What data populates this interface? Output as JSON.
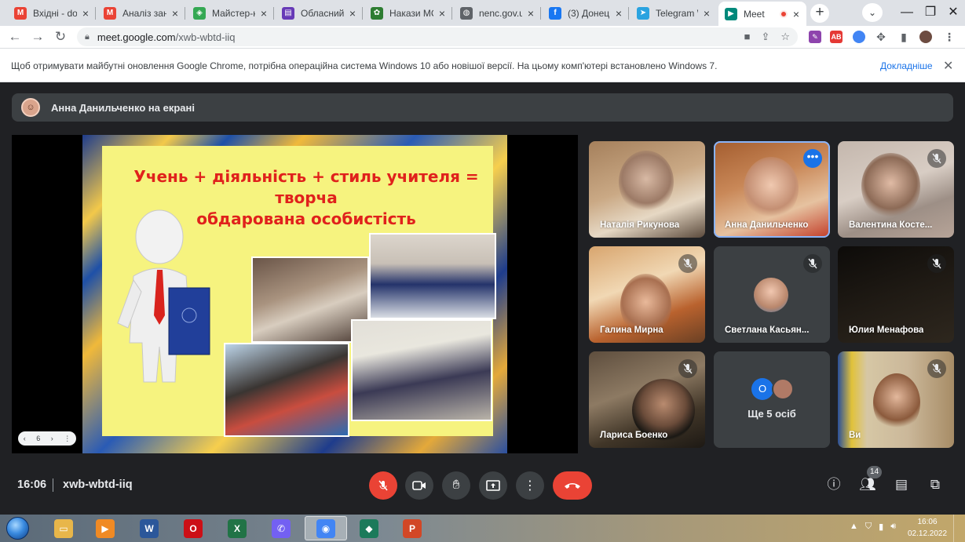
{
  "browser": {
    "tabs": [
      {
        "title": "Вхідні - dor",
        "icon": "gmail-icon",
        "color": "#ea4335",
        "glyph": "M"
      },
      {
        "title": "Аналіз зан",
        "icon": "gmail-icon",
        "color": "#ea4335",
        "glyph": "M"
      },
      {
        "title": "Майстер-к",
        "icon": "shield-site-icon",
        "color": "#34a853",
        "glyph": "◈"
      },
      {
        "title": "Обласний",
        "icon": "forms-icon",
        "color": "#673ab7",
        "glyph": "▤"
      },
      {
        "title": "Накази МС",
        "icon": "ministry-icon",
        "color": "#2e7d32",
        "glyph": "✿"
      },
      {
        "title": "nenc.gov.ua",
        "icon": "globe-icon",
        "color": "#5f6368",
        "glyph": "◍"
      },
      {
        "title": "(3) Донець",
        "icon": "facebook-icon",
        "color": "#1877f2",
        "glyph": "f"
      },
      {
        "title": "Telegram W",
        "icon": "telegram-icon",
        "color": "#2aa3e0",
        "glyph": "➤"
      },
      {
        "title": "Meet",
        "icon": "meet-icon",
        "color": "#00897b",
        "glyph": "▶"
      }
    ],
    "url_host": "meet.google.com",
    "url_path": "/xwb-wbtd-iiq",
    "info_message": "Щоб отримувати майбутні оновлення Google Chrome, потрібна операційна система Windows 10 або новішої версії. На цьому комп'ютері встановлено Windows 7.",
    "info_link": "Докладніше"
  },
  "meet": {
    "presenter_banner": "Анна Данильченко на екрані",
    "slide": {
      "title_line1": "Учень + діяльність + стиль учителя = творча",
      "title_line2": "обдарована  особистість",
      "page": "6"
    },
    "tiles": [
      {
        "name": "Наталія Рикунова",
        "muted": false
      },
      {
        "name": "Анна Данильченко",
        "muted": false,
        "speaking": true
      },
      {
        "name": "Валентина Косте...",
        "muted": true
      },
      {
        "name": "Галина Мирна",
        "muted": true
      },
      {
        "name": "Светлана Касьян...",
        "muted": true
      },
      {
        "name": "Юлия Менафова",
        "muted": true
      },
      {
        "name": "Лариса Боенко",
        "muted": true
      },
      {
        "name": "Ви",
        "muted": true
      }
    ],
    "more": {
      "initial": "О",
      "label": "Ще 5 осіб"
    },
    "time": "16:06",
    "meeting_code": "xwb-wbtd-iiq",
    "participants_count": "14"
  },
  "taskbar": {
    "clock_time": "16:06",
    "clock_date": "02.12.2022",
    "apps": [
      {
        "name": "explorer-icon",
        "color": "#e8b64a",
        "glyph": "▭"
      },
      {
        "name": "media-player-icon",
        "color": "#f08a24",
        "glyph": "▶"
      },
      {
        "name": "word-icon",
        "color": "#2b579a",
        "glyph": "W"
      },
      {
        "name": "opera-icon",
        "color": "#cc0f16",
        "glyph": "O"
      },
      {
        "name": "excel-icon",
        "color": "#217346",
        "glyph": "X"
      },
      {
        "name": "viber-icon",
        "color": "#7360f2",
        "glyph": "✆"
      },
      {
        "name": "chrome-icon",
        "color": "#4285f4",
        "glyph": "◉"
      },
      {
        "name": "app-icon",
        "color": "#1c7a5a",
        "glyph": "◆"
      },
      {
        "name": "powerpoint-icon",
        "color": "#d24726",
        "glyph": "P"
      }
    ]
  }
}
